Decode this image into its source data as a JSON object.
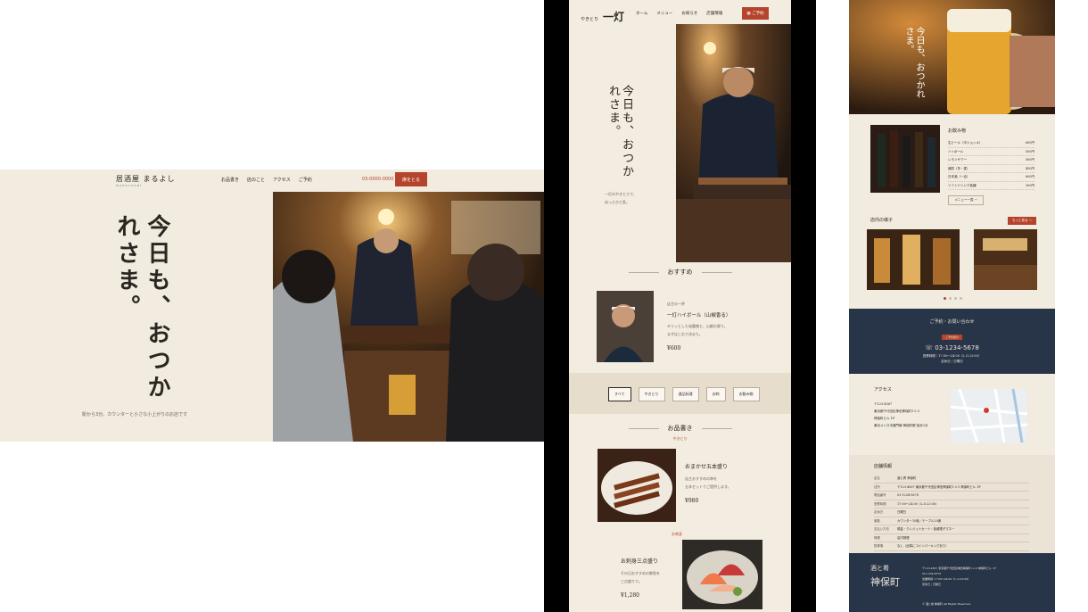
{
  "desktop": {
    "brand": "居酒屋 まるよし",
    "brand_sub": "MARUYOSHI",
    "nav": [
      "お品書き",
      "店のこと",
      "アクセス",
      "ご予約"
    ],
    "phone": "03-0000-0000",
    "cta": "席をとる",
    "headline": "今日も、おつかれさま。",
    "sub": "駅から3分。カウンターと小さな小上がりのお店です"
  },
  "mobile": {
    "logo_small": "やきとり",
    "logo": "一灯",
    "nav": [
      "ホーム",
      "メニュー",
      "お知らせ",
      "店舗情報"
    ],
    "reserve": "ご予約",
    "headline": "今日も、おつかれさま。",
    "hero_text": [
      "一灯のやきとりで、",
      "ほっとひと息。"
    ],
    "recommend": {
      "title": "おすすめ",
      "label": "店主の一杯",
      "name": "一灯ハイボール（山椒香る）",
      "desc": [
        "キリッとした炭酸感と、山椒の香り。",
        "まずはこれで決まり。"
      ],
      "price": "¥600"
    },
    "tabs": [
      "すべて",
      "やきとり",
      "逸品料理",
      "お刺",
      "お飲み物"
    ],
    "menu": {
      "title": "お品書き",
      "cat1": "やきとり",
      "item1": {
        "name": "おまかせ五本盛り",
        "desc": [
          "店主おすすめの串を",
          "五本セットでご提供します。"
        ],
        "price": "¥980"
      },
      "cat2": "お刺身",
      "item2": {
        "name": "お刺身三点盛り",
        "desc": [
          "その日おすすめの鮮魚を",
          "三点盛りで。"
        ],
        "price": "¥1,280"
      }
    }
  },
  "info": {
    "drinks_title": "お飲み物",
    "drinks": [
      [
        "生ビール（中ジョッキ）",
        "600円"
      ],
      [
        "ハイボール",
        "500円"
      ],
      [
        "レモンサワー",
        "500円"
      ],
      [
        "焼酎（芋・麦）",
        "450円"
      ],
      [
        "日本酒（一合）",
        "600円"
      ],
      [
        "ソフトドリンク各種",
        "300円"
      ]
    ],
    "drinks_more": "メニュー一覧 →",
    "interior_title": "店内の様子",
    "interior_more": "もっと見る →",
    "contact": {
      "title": "ご予約・お問い合わせ",
      "badge": "ご予約受付",
      "phone": "03-1234-5678",
      "hours": "営業時間｜17:00〜24:00（L.O.23:00）",
      "closed": "定休日｜日曜日"
    },
    "access": {
      "title": "アクセス",
      "lines": [
        "〒123-4567",
        "東京都千代田区神田神保町1-2-3",
        "神保町ビル 1F",
        "東京メトロ半蔵門線 神保町駅 徒歩2分"
      ]
    },
    "store": {
      "title": "店舗情報",
      "rows": [
        [
          "店名",
          "酒と肴 神保町"
        ],
        [
          "住所",
          "〒123-4567 東京都千代田区神田神保町1-2-3 神保町ビル 1F"
        ],
        [
          "電話番号",
          "03-1234-5678"
        ],
        [
          "営業時間",
          "17:00〜24:00（L.O.23:00）"
        ],
        [
          "定休日",
          "日曜日"
        ],
        [
          "席数",
          "カウンター10席／テーブル20席"
        ],
        [
          "支払い方法",
          "現金・クレジットカード・各種電子マネー"
        ],
        [
          "喫煙",
          "店内禁煙"
        ],
        [
          "駐車場",
          "なし（近隣にコインパーキングあり）"
        ]
      ]
    },
    "footer": {
      "logo_top": "酒と肴",
      "logo": "神保町",
      "lines": [
        "〒123-4567 東京都千代田区神田神保町1-2-3 神保町ビル 1F",
        "03-1234-5678",
        "営業時間 17:00〜24:00（L.O.23:00）",
        "定休日｜日曜日"
      ],
      "copy": "© 酒と肴 神保町 All Rights Reserved."
    }
  }
}
